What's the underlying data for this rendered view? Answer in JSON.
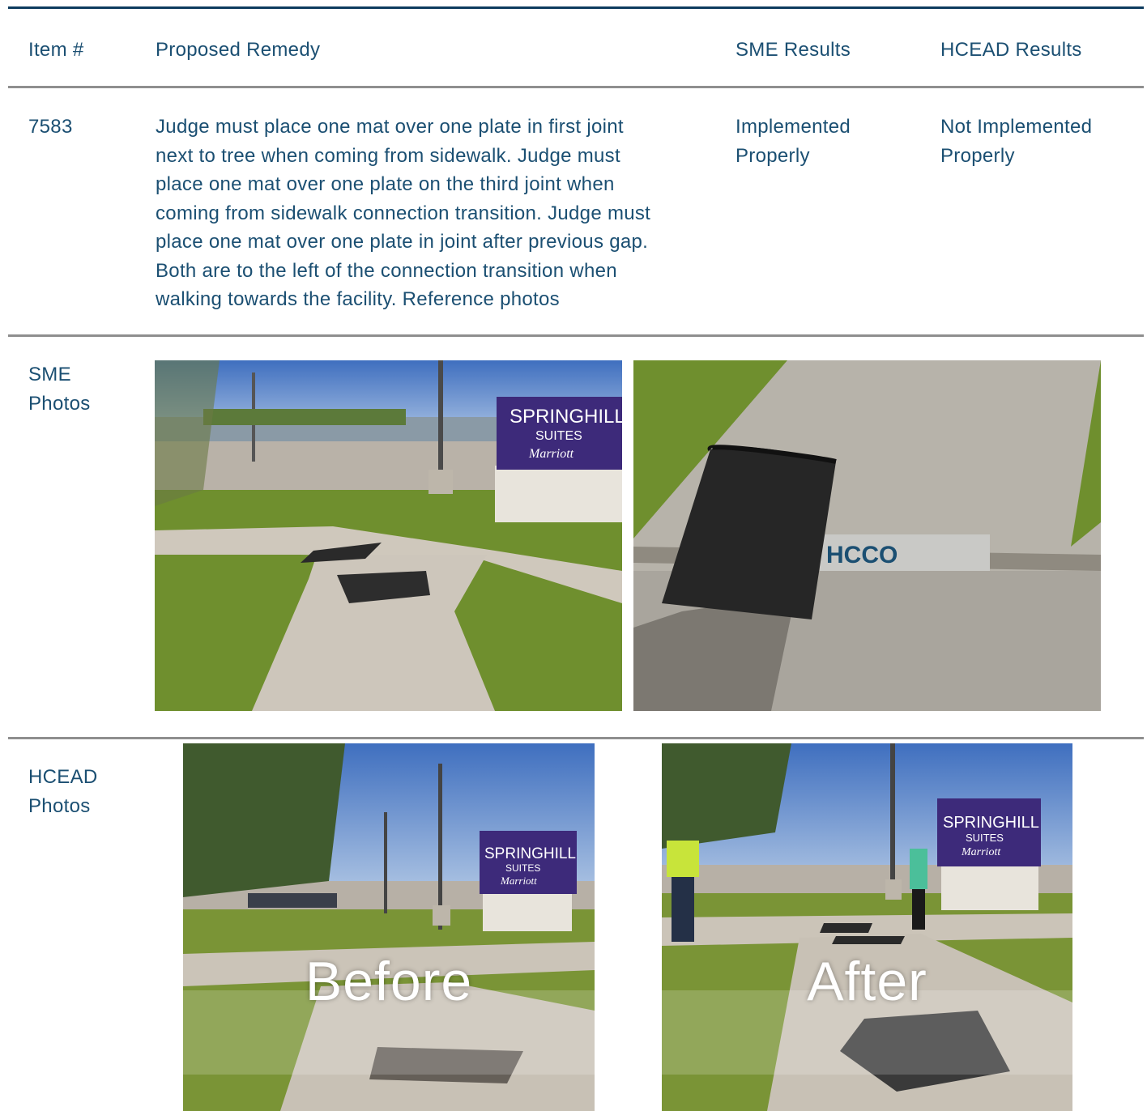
{
  "table": {
    "headers": {
      "item": "Item #",
      "remedy": "Proposed Remedy",
      "sme_results": "SME Results",
      "hcead_results": "HCEAD Results"
    },
    "row": {
      "item": "7583",
      "remedy_lines": [
        "Judge must place one mat over one plate in first joint",
        "next to tree when coming from sidewalk. Judge must",
        "place one mat over one plate on the third joint when",
        "coming from sidewalk connection transition. Judge must",
        "place one mat over one plate in joint after previous gap.",
        "Both are to the left of the connection transition when",
        "walking towards the facility. Reference photos"
      ],
      "sme_result_lines": [
        "Implemented",
        "Properly"
      ],
      "hcead_result_lines": [
        "Not Implemented",
        "Properly"
      ]
    },
    "sme_photos": {
      "label_lines": [
        "SME",
        "Photos"
      ],
      "photos": [
        {
          "sign_lines": [
            "SPRINGHILL",
            "SUITES",
            "Marriott"
          ]
        },
        {
          "plate_text": "HCCO"
        }
      ]
    },
    "hcead_photos": {
      "label_lines": [
        "HCEAD",
        "Photos"
      ],
      "photos": [
        {
          "overlay": "Before",
          "sign_lines": [
            "SPRINGHILL",
            "SUITES",
            "Marriott"
          ]
        },
        {
          "overlay": "After",
          "sign_lines": [
            "SPRINGHILL",
            "SUITES",
            "Marriott"
          ]
        }
      ]
    }
  },
  "colors": {
    "text": "#1b4f72",
    "top_rule": "#0d3b5e",
    "row_rule": "#8f8f8f",
    "sign_purple": "#3d2a7a",
    "grass": "#6f8f2e",
    "sky": "#4f7fc8"
  }
}
